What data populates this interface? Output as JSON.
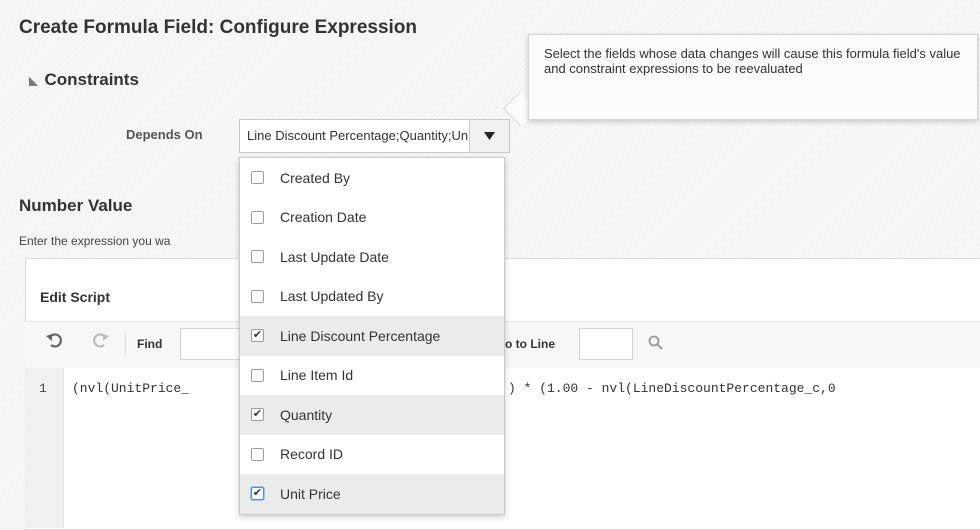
{
  "page": {
    "title": "Create Formula Field: Configure Expression"
  },
  "constraints": {
    "title": "Constraints",
    "depends_on_label": "Depends On",
    "depends_on_value": "Line Discount Percentage;Quantity;Unit Price",
    "tooltip": "Select the fields whose data changes will cause this formula field's value and constraint expressions to be reevaluated"
  },
  "dropdown": {
    "options": [
      {
        "label": "Created By",
        "checked": false
      },
      {
        "label": "Creation Date",
        "checked": false
      },
      {
        "label": "Last Update Date",
        "checked": false
      },
      {
        "label": "Last Updated By",
        "checked": false
      },
      {
        "label": "Line Discount Percentage",
        "checked": true
      },
      {
        "label": "Line Item Id",
        "checked": false
      },
      {
        "label": "Quantity",
        "checked": true
      },
      {
        "label": "Record ID",
        "checked": false
      },
      {
        "label": "Unit Price",
        "checked": true
      }
    ]
  },
  "number_value": {
    "title": "Number Value",
    "description": "Enter the expression you wa"
  },
  "editor": {
    "title": "Edit Script",
    "find_label": "Find",
    "goto_label": "o to Line",
    "line_number": "1",
    "code_left": "(nvl(UnitPrice_",
    "code_right": ") * (1.00 - nvl(LineDiscountPercentage_c,0"
  },
  "icons": {
    "undo": "undo-icon",
    "redo": "redo-icon",
    "search": "search-icon",
    "dropdown": "caret-down-icon",
    "collapse": "collapse-triangle-icon"
  }
}
